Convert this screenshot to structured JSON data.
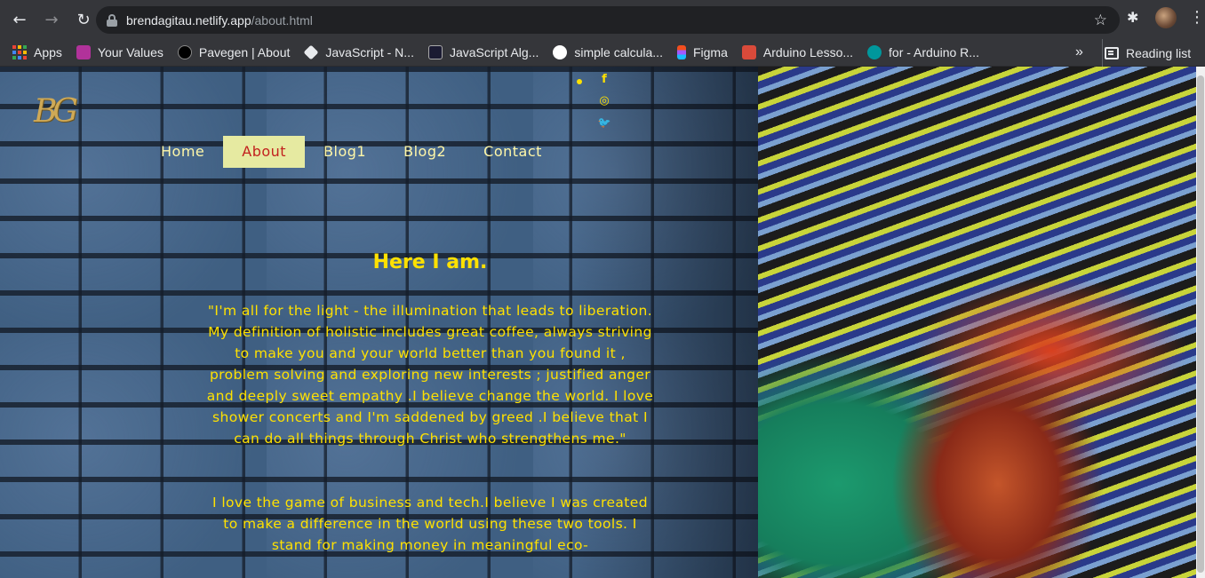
{
  "browser": {
    "url_host": "brendagitau.netlify.app",
    "url_path": "/about.html",
    "back_icon": "←",
    "forward_icon": "→",
    "reload_icon": "↻",
    "star_icon": "☆",
    "puzzle_icon": "✱",
    "kebab_icon": "⋮",
    "bookmarks": [
      {
        "label": "Apps",
        "icon": "apps-grid-icon"
      },
      {
        "label": "Your Values",
        "icon": "values-favicon",
        "color": "#b1329a"
      },
      {
        "label": "Pavegen | About",
        "icon": "pavegen-favicon",
        "color": "#000000"
      },
      {
        "label": "JavaScript - N...",
        "icon": "js-favicon",
        "color": "#e8eaed"
      },
      {
        "label": "JavaScript Alg...",
        "icon": "algo-favicon",
        "color": "#1b1b32"
      },
      {
        "label": "simple calcula...",
        "icon": "codepen-favicon",
        "color": "#ffffff"
      },
      {
        "label": "Figma",
        "icon": "figma-favicon",
        "color": "#f24e1e"
      },
      {
        "label": "Arduino Lesso...",
        "icon": "arduino-lesson-favicon",
        "color": "#d94a3a"
      },
      {
        "label": "for - Arduino R...",
        "icon": "arduino-favicon",
        "color": "#00979c"
      }
    ],
    "more_icon": "»",
    "reading_list": "Reading list"
  },
  "page": {
    "logo": "BG",
    "social": {
      "facebook": "f",
      "instagram": "◎",
      "twitter": "🐦"
    },
    "nav": [
      {
        "label": "Home",
        "active": false
      },
      {
        "label": "About",
        "active": true
      },
      {
        "label": "Blog1",
        "active": false
      },
      {
        "label": "Blog2",
        "active": false
      },
      {
        "label": "Contact",
        "active": false
      }
    ],
    "heading": "Here I am.",
    "paragraph1": "\"I'm all for the light - the illumination that leads to liberation. My definition of holistic includes great coffee, always striving to make you and your world better than you found it , problem solving and exploring new interests ; justified anger and deeply sweet empathy .I believe change the world. I love shower concerts and I'm saddened by greed .I believe that I can do all things through Christ who strengthens me.\"",
    "paragraph2": "I love the game of business and tech.I believe I was created to make a difference in the world using these two tools. I stand for making money in meaningful eco-",
    "accent_color": "#ffe100",
    "active_nav_bg": "#e6eaa1",
    "active_nav_text": "#c2211e"
  }
}
